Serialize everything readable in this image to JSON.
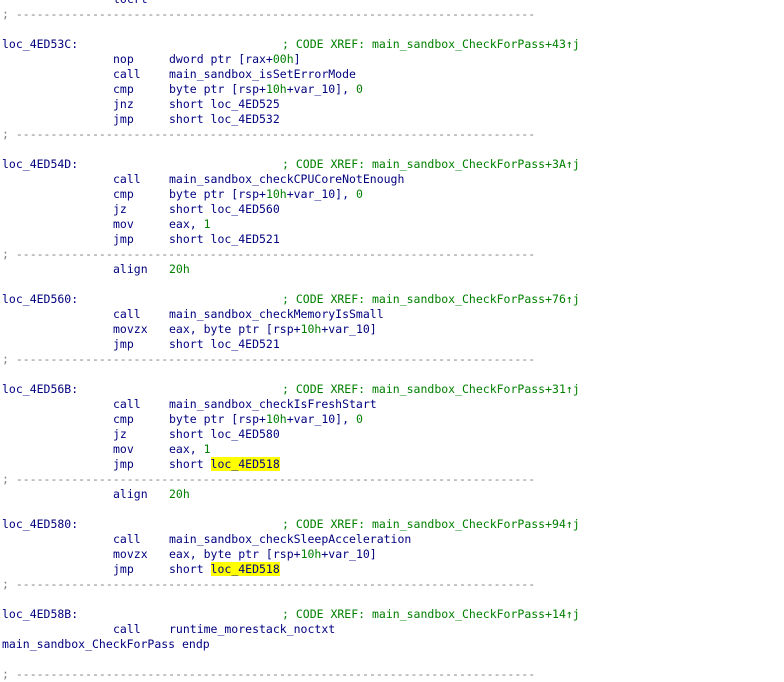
{
  "listing": {
    "top_fragment": "locrt",
    "separator": "; ---------------------------------------------------------------------------",
    "blocks": {
      "b1": {
        "label": "loc_4ED53C:",
        "xref": "; CODE XREF: main_sandbox_CheckForPass+43↑j",
        "lines": [
          {
            "mnem": "nop",
            "ops_pre": "dword ptr [rax+",
            "ops_num": "00h",
            "ops_post": "]"
          },
          {
            "mnem": "call",
            "ops": "main_sandbox_isSetErrorMode"
          },
          {
            "mnem": "cmp",
            "ops_pre": "byte ptr [rsp+",
            "ops_num": "10h",
            "ops_mid": "+var_10], ",
            "ops_num2": "0"
          },
          {
            "mnem": "jnz",
            "ops": "short loc_4ED525"
          },
          {
            "mnem": "jmp",
            "ops": "short loc_4ED532"
          }
        ]
      },
      "b2": {
        "label": "loc_4ED54D:",
        "xref": "; CODE XREF: main_sandbox_CheckForPass+3A↑j",
        "lines": [
          {
            "mnem": "call",
            "ops": "main_sandbox_checkCPUCoreNotEnough"
          },
          {
            "mnem": "cmp",
            "ops_pre": "byte ptr [rsp+",
            "ops_num": "10h",
            "ops_mid": "+var_10], ",
            "ops_num2": "0"
          },
          {
            "mnem": "jz",
            "ops": "short loc_4ED560"
          },
          {
            "mnem": "mov",
            "ops_pre": "eax, ",
            "ops_num": "1"
          },
          {
            "mnem": "jmp",
            "ops": "short loc_4ED521"
          }
        ]
      },
      "align1": {
        "mnem": "align",
        "ops_num": "20h"
      },
      "b3": {
        "label": "loc_4ED560:",
        "xref": "; CODE XREF: main_sandbox_CheckForPass+76↑j",
        "lines": [
          {
            "mnem": "call",
            "ops": "main_sandbox_checkMemoryIsSmall"
          },
          {
            "mnem": "movzx",
            "ops_pre": "eax, byte ptr [rsp+",
            "ops_num": "10h",
            "ops_mid": "+var_10]"
          },
          {
            "mnem": "jmp",
            "ops": "short loc_4ED521"
          }
        ]
      },
      "b4": {
        "label": "loc_4ED56B:",
        "xref": "; CODE XREF: main_sandbox_CheckForPass+31↑j",
        "lines": [
          {
            "mnem": "call",
            "ops": "main_sandbox_checkIsFreshStart"
          },
          {
            "mnem": "cmp",
            "ops_pre": "byte ptr [rsp+",
            "ops_num": "10h",
            "ops_mid": "+var_10], ",
            "ops_num2": "0"
          },
          {
            "mnem": "jz",
            "ops": "short loc_4ED580"
          },
          {
            "mnem": "mov",
            "ops_pre": "eax, ",
            "ops_num": "1"
          },
          {
            "mnem": "jmp",
            "ops_pre": "short ",
            "ops_hl": "loc_4ED518"
          }
        ]
      },
      "align2": {
        "mnem": "align",
        "ops_num": "20h"
      },
      "b5": {
        "label": "loc_4ED580:",
        "xref": "; CODE XREF: main_sandbox_CheckForPass+94↑j",
        "lines": [
          {
            "mnem": "call",
            "ops": "main_sandbox_checkSleepAcceleration"
          },
          {
            "mnem": "movzx",
            "ops_pre": "eax, byte ptr [rsp+",
            "ops_num": "10h",
            "ops_mid": "+var_10]"
          },
          {
            "mnem": "jmp",
            "ops_pre": "short ",
            "ops_hl": "loc_4ED518"
          }
        ]
      },
      "b6": {
        "label": "loc_4ED58B:",
        "xref": "; CODE XREF: main_sandbox_CheckForPass+14↑j",
        "lines": [
          {
            "mnem": "call",
            "ops": "runtime_morestack_noctxt"
          }
        ]
      },
      "endp": "main_sandbox_CheckForPass endp"
    }
  }
}
